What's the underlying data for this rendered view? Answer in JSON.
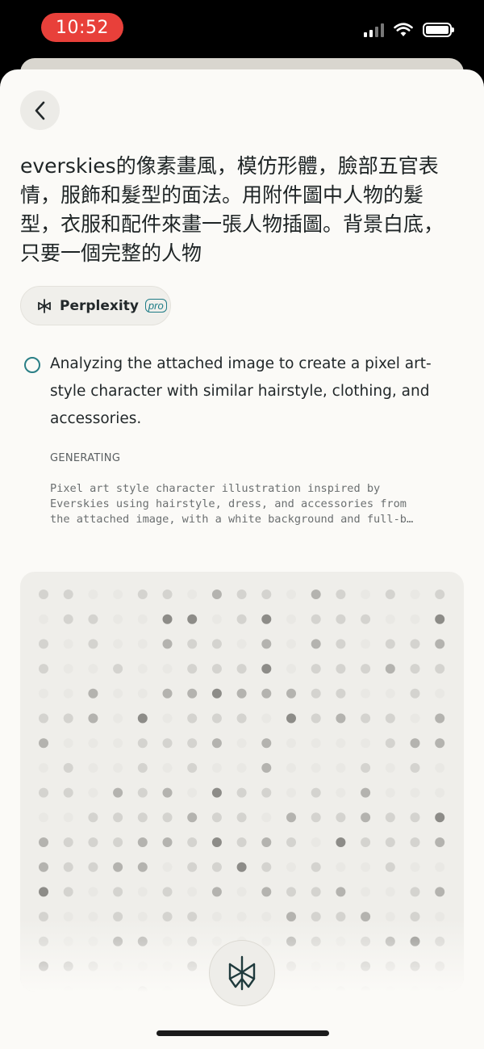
{
  "status": {
    "time": "10:52",
    "time_pill_color": "#e8403a",
    "icons": [
      "cellular-signal-icon",
      "wifi-icon",
      "battery-icon"
    ]
  },
  "header": {
    "back_icon": "chevron-left-icon"
  },
  "prompt": {
    "text": "everskies的像素畫風，模仿形體，臉部五官表情，服飾和髮型的面法。用附件圖中人物的髮型，衣服和配件來畫一張人物插圖。背景白底，只要一個完整的人物"
  },
  "model": {
    "name": "Perplexity",
    "badge": "pro",
    "icon": "perplexity-logo-icon"
  },
  "step": {
    "text": "Analyzing the attached image to create a pixel art-style character with similar hairstyle, clothing, and accessories."
  },
  "generating": {
    "label": "GENERATING",
    "lines": [
      "Pixel art style character illustration inspired by",
      "Everskies using hairstyle, dress, and accessories from",
      "the attached image, with a white background and full-b…"
    ]
  },
  "loader": {
    "icon": "perplexity-logo-icon",
    "dot_colors": [
      "#e9e8e4",
      "#d4d3cf",
      "#b4b3af",
      "#8d8c88"
    ]
  },
  "colors": {
    "accent": "#2a7f86",
    "sheet_bg": "#fbfaf7"
  }
}
